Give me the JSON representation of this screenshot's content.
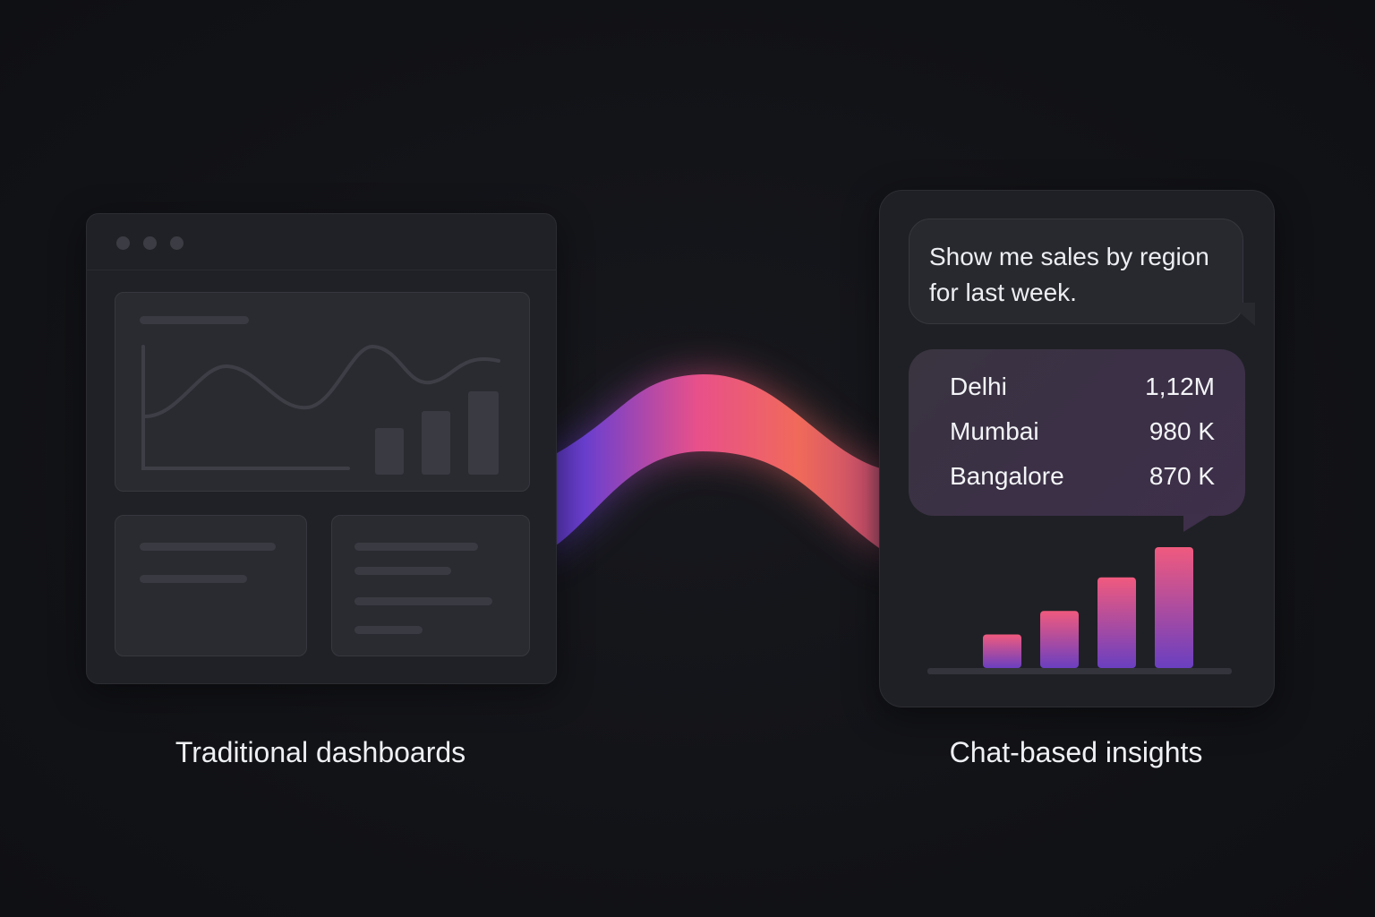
{
  "left": {
    "caption": "Traditional dashboards"
  },
  "right": {
    "caption": "Chat-based insights",
    "user_message": "Show me sales by region for last week.",
    "results": [
      {
        "region": "Delhi",
        "value": "1,12M"
      },
      {
        "region": "Mumbai",
        "value": "980 K"
      },
      {
        "region": "Bangalore",
        "value": "870 K"
      }
    ]
  },
  "colors": {
    "ribbon_start": "#6a3fd0",
    "ribbon_mid": "#e8508a",
    "ribbon_end": "#f06a5a",
    "bar_top": "#f05a7e",
    "bar_bottom": "#6a3fc0"
  },
  "chart_data": {
    "type": "bar",
    "categories": [
      "",
      "",
      "",
      ""
    ],
    "values": [
      1.0,
      1.7,
      2.7,
      3.6
    ],
    "title": "",
    "xlabel": "",
    "ylabel": "",
    "ylim": [
      0,
      4
    ]
  }
}
